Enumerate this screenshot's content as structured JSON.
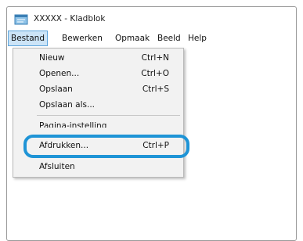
{
  "window": {
    "title": "XXXXX - Kladblok"
  },
  "menubar": {
    "items": [
      "Bestand",
      "Bewerken",
      "Opmaak",
      "Beeld",
      "Help"
    ]
  },
  "file_menu": {
    "items": [
      {
        "label": "Nieuw",
        "shortcut": "Ctrl+N"
      },
      {
        "label": "Openen...",
        "shortcut": "Ctrl+O"
      },
      {
        "label": "Opslaan",
        "shortcut": "Ctrl+S"
      },
      {
        "label": "Opslaan als...",
        "shortcut": ""
      },
      {
        "label": "Pagina-instelling",
        "shortcut": ""
      },
      {
        "label": "Afdrukken...",
        "shortcut": "Ctrl+P"
      },
      {
        "label": "Afsluiten",
        "shortcut": ""
      }
    ]
  },
  "colors": {
    "highlight_ring": "#1f94d6",
    "menu_active_bg": "#cce4f7"
  },
  "icons": {
    "app": "notepad-icon"
  }
}
